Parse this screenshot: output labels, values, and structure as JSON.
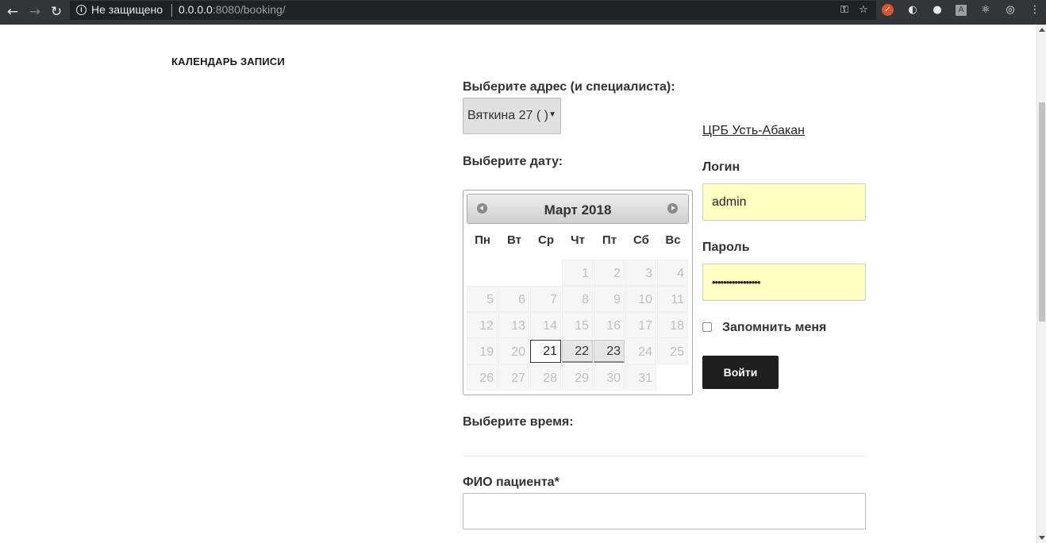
{
  "browser": {
    "security_label": "Не защищено",
    "url_host": "0.0.0.0",
    "url_rest": ":8080/booking/"
  },
  "page": {
    "heading": "КАЛЕНДАРЬ ЗАПИСИ",
    "address_label": "Выберите адрес (и специалиста):",
    "address_selected": "Вяткина 27 ( )",
    "date_label": "Выберите дату:",
    "time_label": "Выберите время:",
    "patient_label": "ФИО пациента*"
  },
  "calendar": {
    "title": "Март 2018",
    "weekdays": [
      "Пн",
      "Вт",
      "Ср",
      "Чт",
      "Пт",
      "Сб",
      "Вс"
    ],
    "leading_blank_days": 3,
    "days_in_month": 31,
    "active_day": 21,
    "available_days": [
      22,
      23
    ]
  },
  "login": {
    "org_link": "ЦРБ Усть-Абакан",
    "login_label": "Логин",
    "login_value": "admin",
    "password_label": "Пароль",
    "password_masked": "•••••••••••••••••",
    "remember_label": "Запомнить меня",
    "submit_label": "Войти"
  }
}
